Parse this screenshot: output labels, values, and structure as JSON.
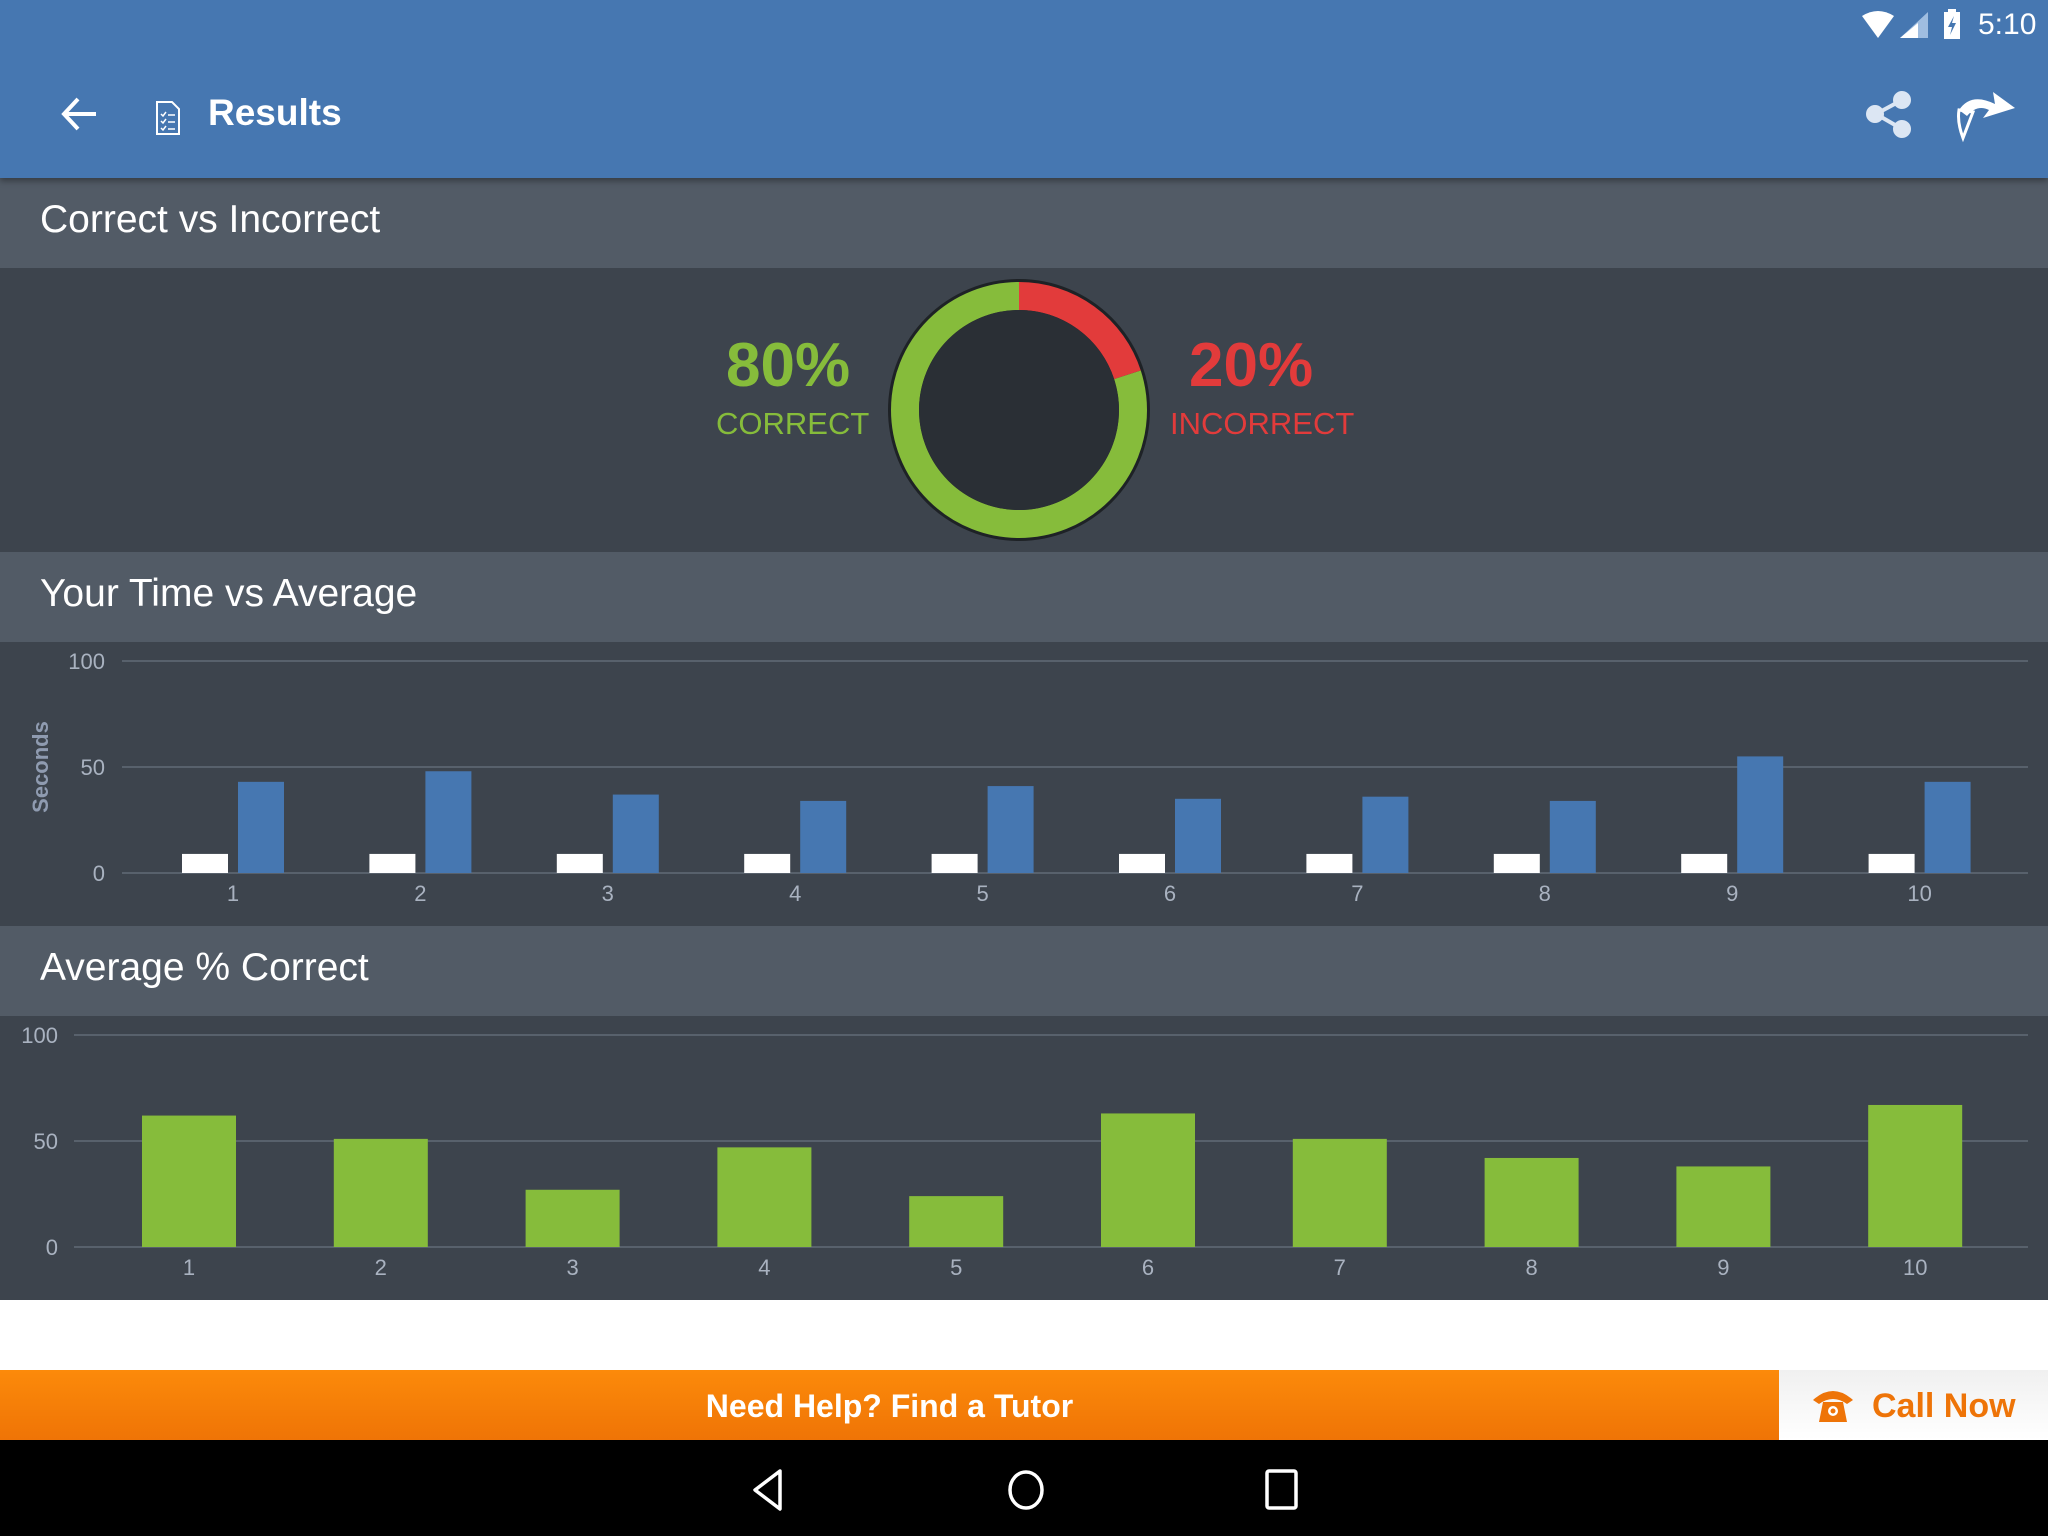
{
  "status_bar": {
    "time": "5:10",
    "icons": [
      "wifi-icon",
      "cell-signal-icon",
      "battery-charging-icon"
    ]
  },
  "app_bar": {
    "title": "Results",
    "back_icon": "arrow-left-icon",
    "title_icon": "checklist-document-icon",
    "actions": [
      "share-icon",
      "forward-arrow-icon"
    ],
    "background_color": "#4677b1"
  },
  "sections": {
    "correct_vs_incorrect": {
      "title": "Correct vs Incorrect",
      "correct_value": "80%",
      "correct_label": "CORRECT",
      "incorrect_value": "20%",
      "incorrect_label": "INCORRECT",
      "correct_color": "#86bc3b",
      "incorrect_color": "#e23b3b"
    },
    "time_vs_average": {
      "title": "Your Time vs Average"
    },
    "average_correct": {
      "title": "Average % Correct"
    }
  },
  "chart_data": [
    {
      "type": "pie",
      "title": "Correct vs Incorrect",
      "style": "donut",
      "categories": [
        "Correct",
        "Incorrect"
      ],
      "values": [
        80,
        20
      ],
      "colors": [
        "#86bc3b",
        "#e23b3b"
      ]
    },
    {
      "type": "bar",
      "title": "Your Time vs Average",
      "xlabel": "",
      "ylabel": "Seconds",
      "ylim": [
        0,
        100
      ],
      "yticks": [
        0,
        50,
        100
      ],
      "grid": true,
      "categories": [
        "1",
        "2",
        "3",
        "4",
        "5",
        "6",
        "7",
        "8",
        "9",
        "10"
      ],
      "series": [
        {
          "name": "Your Time",
          "color": "#ffffff",
          "values": [
            9,
            9,
            9,
            9,
            9,
            9,
            9,
            9,
            9,
            9
          ]
        },
        {
          "name": "Average",
          "color": "#4677b1",
          "values": [
            43,
            48,
            37,
            34,
            41,
            35,
            36,
            34,
            55,
            43
          ]
        }
      ]
    },
    {
      "type": "bar",
      "title": "Average % Correct",
      "xlabel": "",
      "ylabel": "",
      "ylim": [
        0,
        100
      ],
      "yticks": [
        0,
        50,
        100
      ],
      "grid": true,
      "categories": [
        "1",
        "2",
        "3",
        "4",
        "5",
        "6",
        "7",
        "8",
        "9",
        "10"
      ],
      "series": [
        {
          "name": "Average % Correct",
          "color": "#86bc3b",
          "values": [
            62,
            51,
            27,
            47,
            24,
            63,
            51,
            42,
            38,
            67
          ]
        }
      ]
    }
  ],
  "footer": {
    "tutor_label": "Need Help? Find a Tutor",
    "call_label": "Call Now",
    "call_icon": "phone-icon"
  },
  "nav_bar": {
    "buttons": [
      "back-nav-icon",
      "home-nav-icon",
      "recents-nav-icon"
    ]
  }
}
